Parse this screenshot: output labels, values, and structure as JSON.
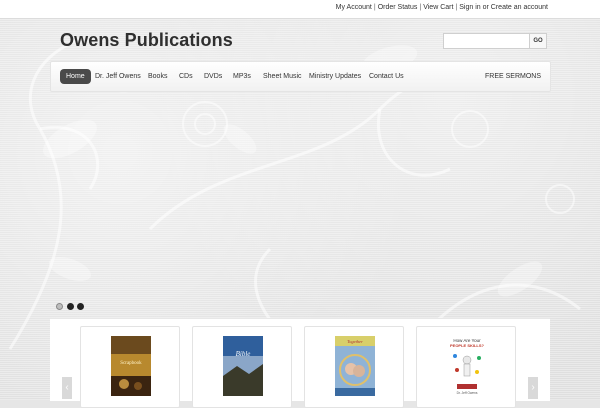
{
  "topbar": {
    "my_account": "My Account",
    "order_status": "Order Status",
    "view_cart": "View Cart",
    "sign_in": "Sign in",
    "or": "or",
    "create_account": "Create an account",
    "sep": "|"
  },
  "header": {
    "title": "Owens Publications"
  },
  "search": {
    "value": "",
    "go_label": "GO"
  },
  "nav": {
    "items": [
      "Home",
      "Dr. Jeff Owens",
      "Books",
      "CDs",
      "DVDs",
      "MP3s",
      "Sheet Music",
      "Ministry Updates",
      "Contact Us"
    ],
    "free_sermons": "FREE SERMONS"
  },
  "slider": {
    "dot_count": 3,
    "current_index": 0
  },
  "products": {
    "covers": [
      {
        "top": "#6b4a1e",
        "mid": "#b8892e",
        "bottom": "#3b2410"
      },
      {
        "top": "#2f5f9c",
        "mid": "#8aa6c8",
        "bottom": "#3a3a2a"
      },
      {
        "top": "#d8cf6a",
        "mid": "#8fb3d6",
        "bottom": "#3a6aa0"
      },
      {
        "top": "#ffffff",
        "mid": "#f4f4f4",
        "bottom": "#ffffff"
      }
    ],
    "card4": {
      "line1": "How Are Your",
      "line2": "PEOPLE SKILLS?",
      "author": "Dr. Jeff Owens"
    },
    "card1_title": "Scrapbook",
    "card2_title": "Bible",
    "card3_title": "Together"
  },
  "colors": {
    "nav_active_bg": "#4a4a4a",
    "background": "#e3e3e3"
  }
}
